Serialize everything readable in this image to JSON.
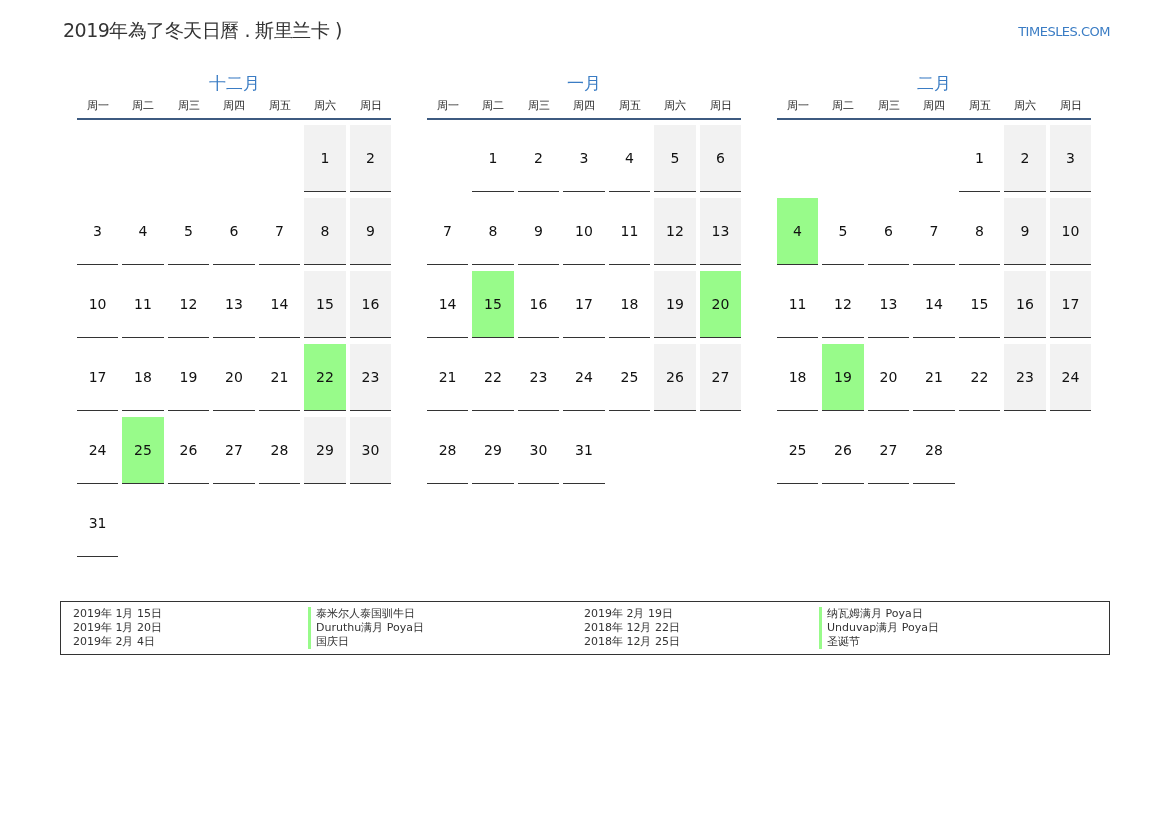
{
  "title": "2019年為了冬天日曆 . 斯里兰卡 )",
  "logo": "TIMESLES.COM",
  "months": [
    {
      "name": "十二月",
      "weekdays": [
        "周一",
        "周二",
        "周三",
        "周四",
        "周五",
        "周六",
        "周日"
      ],
      "weeks": [
        [
          {
            "kind": "blank"
          },
          {
            "kind": "blank"
          },
          {
            "kind": "blank"
          },
          {
            "kind": "blank"
          },
          {
            "kind": "blank"
          },
          {
            "kind": "weekend",
            "day": "1"
          },
          {
            "kind": "weekend",
            "day": "2"
          }
        ],
        [
          {
            "kind": "weekday",
            "day": "3"
          },
          {
            "kind": "weekday",
            "day": "4"
          },
          {
            "kind": "weekday",
            "day": "5"
          },
          {
            "kind": "weekday",
            "day": "6"
          },
          {
            "kind": "weekday",
            "day": "7"
          },
          {
            "kind": "weekend",
            "day": "8"
          },
          {
            "kind": "weekend",
            "day": "9"
          }
        ],
        [
          {
            "kind": "weekday",
            "day": "10"
          },
          {
            "kind": "weekday",
            "day": "11"
          },
          {
            "kind": "weekday",
            "day": "12"
          },
          {
            "kind": "weekday",
            "day": "13"
          },
          {
            "kind": "weekday",
            "day": "14"
          },
          {
            "kind": "weekend",
            "day": "15"
          },
          {
            "kind": "weekend",
            "day": "16"
          }
        ],
        [
          {
            "kind": "weekday",
            "day": "17"
          },
          {
            "kind": "weekday",
            "day": "18"
          },
          {
            "kind": "weekday",
            "day": "19"
          },
          {
            "kind": "weekday",
            "day": "20"
          },
          {
            "kind": "weekday",
            "day": "21"
          },
          {
            "kind": "holiday",
            "day": "22"
          },
          {
            "kind": "weekend",
            "day": "23"
          }
        ],
        [
          {
            "kind": "weekday",
            "day": "24"
          },
          {
            "kind": "holiday",
            "day": "25"
          },
          {
            "kind": "weekday",
            "day": "26"
          },
          {
            "kind": "weekday",
            "day": "27"
          },
          {
            "kind": "weekday",
            "day": "28"
          },
          {
            "kind": "weekend",
            "day": "29"
          },
          {
            "kind": "weekend",
            "day": "30"
          }
        ],
        [
          {
            "kind": "weekday",
            "day": "31"
          }
        ]
      ]
    },
    {
      "name": "一月",
      "weekdays": [
        "周一",
        "周二",
        "周三",
        "周四",
        "周五",
        "周六",
        "周日"
      ],
      "weeks": [
        [
          {
            "kind": "blank"
          },
          {
            "kind": "weekday",
            "day": "1"
          },
          {
            "kind": "weekday",
            "day": "2"
          },
          {
            "kind": "weekday",
            "day": "3"
          },
          {
            "kind": "weekday",
            "day": "4"
          },
          {
            "kind": "weekend",
            "day": "5"
          },
          {
            "kind": "weekend",
            "day": "6"
          }
        ],
        [
          {
            "kind": "weekday",
            "day": "7"
          },
          {
            "kind": "weekday",
            "day": "8"
          },
          {
            "kind": "weekday",
            "day": "9"
          },
          {
            "kind": "weekday",
            "day": "10"
          },
          {
            "kind": "weekday",
            "day": "11"
          },
          {
            "kind": "weekend",
            "day": "12"
          },
          {
            "kind": "weekend",
            "day": "13"
          }
        ],
        [
          {
            "kind": "weekday",
            "day": "14"
          },
          {
            "kind": "holiday",
            "day": "15"
          },
          {
            "kind": "weekday",
            "day": "16"
          },
          {
            "kind": "weekday",
            "day": "17"
          },
          {
            "kind": "weekday",
            "day": "18"
          },
          {
            "kind": "weekend",
            "day": "19"
          },
          {
            "kind": "holiday",
            "day": "20"
          }
        ],
        [
          {
            "kind": "weekday",
            "day": "21"
          },
          {
            "kind": "weekday",
            "day": "22"
          },
          {
            "kind": "weekday",
            "day": "23"
          },
          {
            "kind": "weekday",
            "day": "24"
          },
          {
            "kind": "weekday",
            "day": "25"
          },
          {
            "kind": "weekend",
            "day": "26"
          },
          {
            "kind": "weekend",
            "day": "27"
          }
        ],
        [
          {
            "kind": "weekday",
            "day": "28"
          },
          {
            "kind": "weekday",
            "day": "29"
          },
          {
            "kind": "weekday",
            "day": "30"
          },
          {
            "kind": "weekday",
            "day": "31"
          }
        ]
      ]
    },
    {
      "name": "二月",
      "weekdays": [
        "周一",
        "周二",
        "周三",
        "周四",
        "周五",
        "周六",
        "周日"
      ],
      "weeks": [
        [
          {
            "kind": "blank"
          },
          {
            "kind": "blank"
          },
          {
            "kind": "blank"
          },
          {
            "kind": "blank"
          },
          {
            "kind": "weekday",
            "day": "1"
          },
          {
            "kind": "weekend",
            "day": "2"
          },
          {
            "kind": "weekend",
            "day": "3"
          }
        ],
        [
          {
            "kind": "holiday",
            "day": "4"
          },
          {
            "kind": "weekday",
            "day": "5"
          },
          {
            "kind": "weekday",
            "day": "6"
          },
          {
            "kind": "weekday",
            "day": "7"
          },
          {
            "kind": "weekday",
            "day": "8"
          },
          {
            "kind": "weekend",
            "day": "9"
          },
          {
            "kind": "weekend",
            "day": "10"
          }
        ],
        [
          {
            "kind": "weekday",
            "day": "11"
          },
          {
            "kind": "weekday",
            "day": "12"
          },
          {
            "kind": "weekday",
            "day": "13"
          },
          {
            "kind": "weekday",
            "day": "14"
          },
          {
            "kind": "weekday",
            "day": "15"
          },
          {
            "kind": "weekend",
            "day": "16"
          },
          {
            "kind": "weekend",
            "day": "17"
          }
        ],
        [
          {
            "kind": "weekday",
            "day": "18"
          },
          {
            "kind": "holiday",
            "day": "19"
          },
          {
            "kind": "weekday",
            "day": "20"
          },
          {
            "kind": "weekday",
            "day": "21"
          },
          {
            "kind": "weekday",
            "day": "22"
          },
          {
            "kind": "weekend",
            "day": "23"
          },
          {
            "kind": "weekend",
            "day": "24"
          }
        ],
        [
          {
            "kind": "weekday",
            "day": "25"
          },
          {
            "kind": "weekday",
            "day": "26"
          },
          {
            "kind": "weekday",
            "day": "27"
          },
          {
            "kind": "weekday",
            "day": "28"
          }
        ]
      ]
    }
  ],
  "legend": [
    {
      "entries": [
        {
          "date": "2019年 1月 15日",
          "name": "泰米尔人泰国驯牛日"
        },
        {
          "date": "2019年 1月 20日",
          "name": "Duruthu满月 Poya日"
        },
        {
          "date": "2019年 2月 4日",
          "name": "国庆日"
        }
      ]
    },
    {
      "entries": [
        {
          "date": "2019年 2月 19日",
          "name": "纳瓦姆满月 Poya日"
        },
        {
          "date": "2018年 12月 22日",
          "name": "Unduvap满月 Poya日"
        },
        {
          "date": "2018年 12月 25日",
          "name": "圣诞节"
        }
      ]
    }
  ]
}
